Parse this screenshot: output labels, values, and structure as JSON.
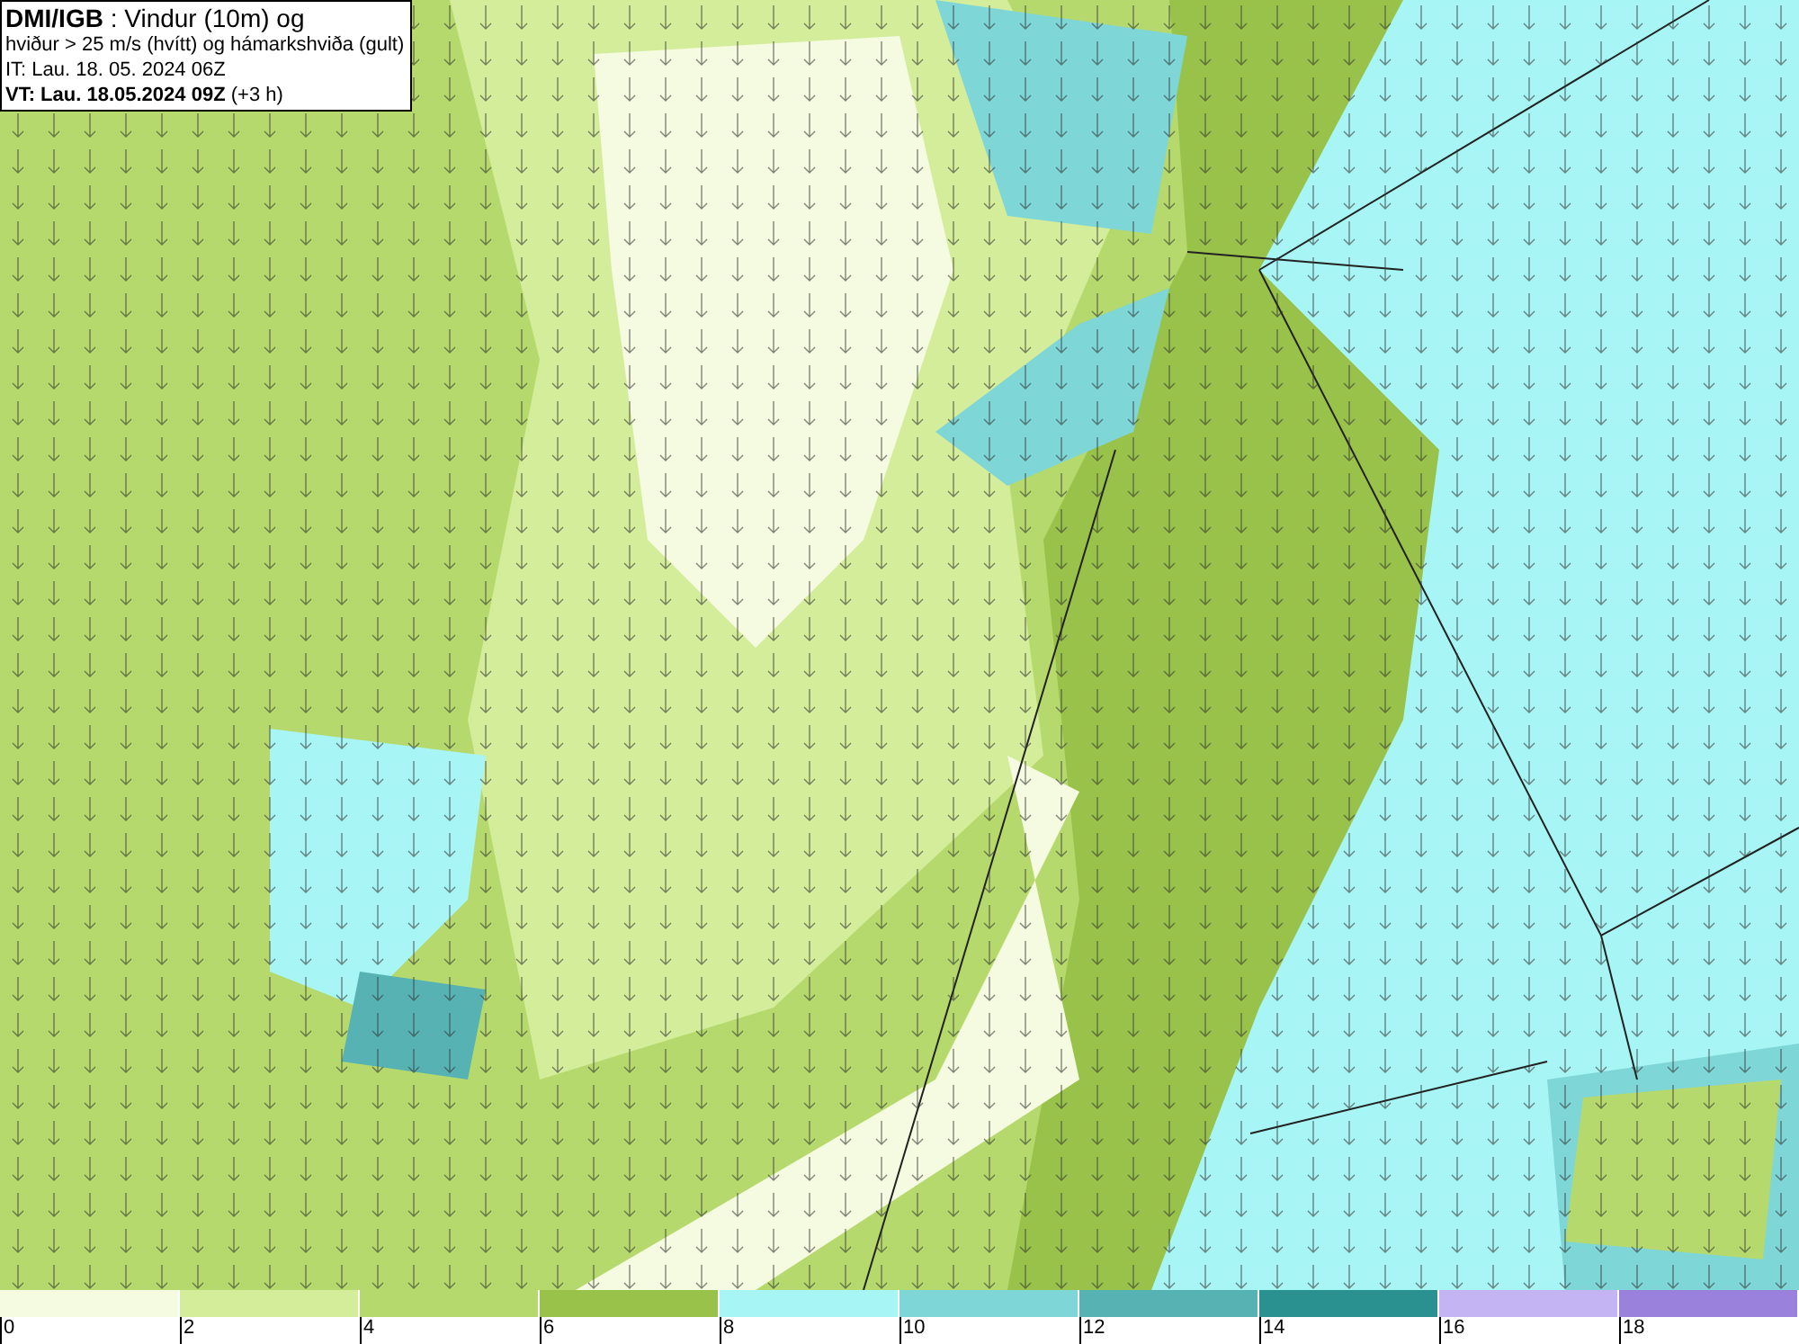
{
  "title_box": {
    "lines": [
      "**DMI/IGB** : Vindur (10m) og",
      "hviður > 25 m/s (hvítt) og hámarkshviða (gult)",
      "IT: Lau. 18. 05. 2024 06Z",
      "**VT: Lau. 18.05.2024 09Z** (+3 h)"
    ]
  },
  "legend": {
    "swatches": [
      {
        "color": "#f5fbe0"
      },
      {
        "color": "#d4ed9a"
      },
      {
        "color": "#b5d96c"
      },
      {
        "color": "#99c24a"
      },
      {
        "color": "#a8f5f5"
      },
      {
        "color": "#7fd6d6"
      },
      {
        "color": "#57b3b3"
      },
      {
        "color": "#2a9090"
      },
      {
        "color": "#c4b4f4"
      },
      {
        "color": "#9a82dc"
      }
    ],
    "ticks": [
      "0",
      "2",
      "4",
      "6",
      "8",
      "10",
      "12",
      "14",
      "16",
      "18"
    ]
  }
}
